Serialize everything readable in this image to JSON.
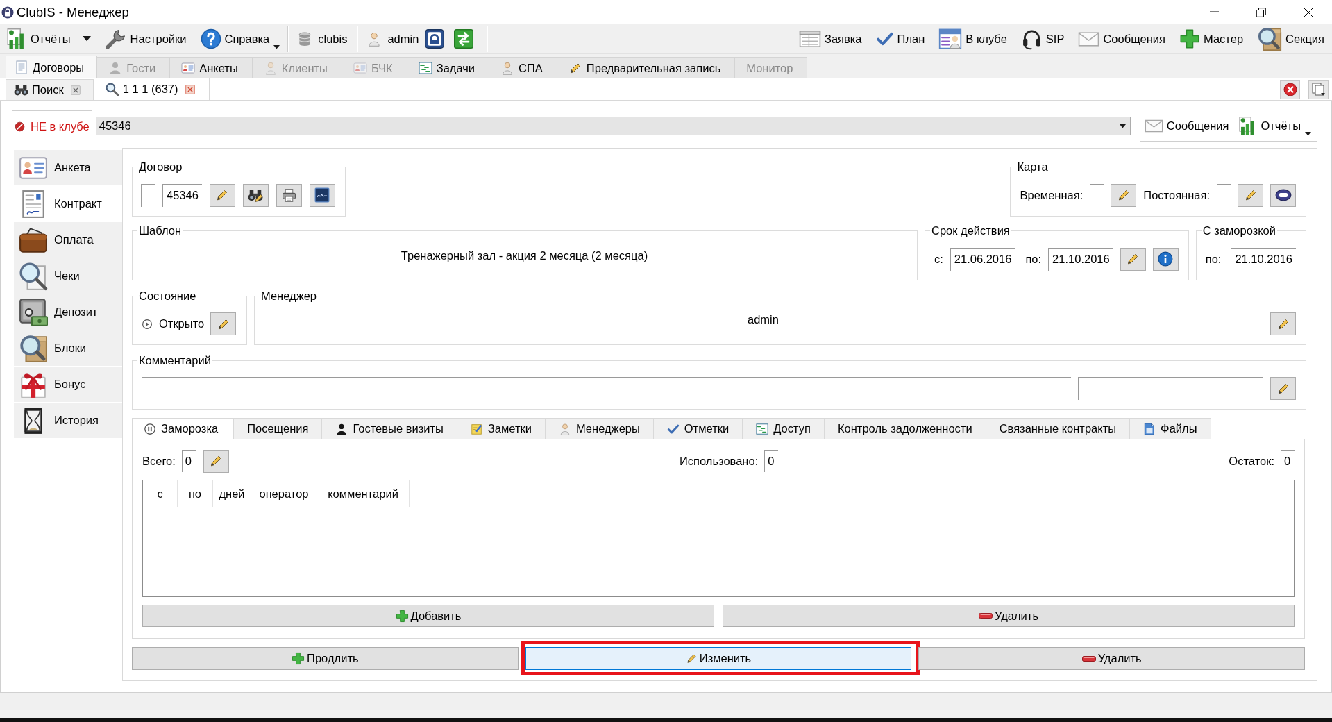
{
  "window": {
    "title": "ClubIS - Менеджер"
  },
  "toolbar": {
    "left": [
      {
        "label": "Отчёты",
        "kind": "dropdown"
      },
      {
        "label": "Настройки",
        "kind": "button"
      },
      {
        "label": "Справка",
        "kind": "menu"
      },
      {
        "label": "clubis",
        "kind": "database"
      },
      {
        "label": "admin",
        "kind": "user"
      }
    ],
    "right": [
      {
        "label": "Заявка"
      },
      {
        "label": "План"
      },
      {
        "label": "В клубе"
      },
      {
        "label": "SIP"
      },
      {
        "label": "Сообщения"
      },
      {
        "label": "Мастер"
      },
      {
        "label": "Секция"
      }
    ]
  },
  "main_tabs": [
    {
      "label": "Договоры",
      "selected": true,
      "disabled": false
    },
    {
      "label": "Гости",
      "selected": false,
      "disabled": true
    },
    {
      "label": "Анкеты",
      "selected": false,
      "disabled": false
    },
    {
      "label": "Клиенты",
      "selected": false,
      "disabled": true
    },
    {
      "label": "БЧК",
      "selected": false,
      "disabled": true
    },
    {
      "label": "Задачи",
      "selected": false,
      "disabled": false
    },
    {
      "label": "СПА",
      "selected": false,
      "disabled": false
    },
    {
      "label": "Предварительная запись",
      "selected": false,
      "disabled": false
    },
    {
      "label": "Монитор",
      "selected": false,
      "disabled": true
    }
  ],
  "document_tabs": [
    {
      "label": "Поиск",
      "selected": false
    },
    {
      "label": "1 1 1 (637)",
      "selected": true
    }
  ],
  "client": {
    "status": "НЕ в клубе",
    "in_club": false,
    "card_number": "45346",
    "buttons": [
      {
        "label": "Сообщения",
        "kind": "messages"
      },
      {
        "label": "Отчёты",
        "kind": "reports"
      }
    ]
  },
  "nav": [
    {
      "label": "Анкета",
      "selected": false
    },
    {
      "label": "Контракт",
      "selected": true
    },
    {
      "label": "Оплата",
      "selected": false
    },
    {
      "label": "Чеки",
      "selected": false
    },
    {
      "label": "Депозит",
      "selected": false
    },
    {
      "label": "Блоки",
      "selected": false
    },
    {
      "label": "Бонус",
      "selected": false
    },
    {
      "label": "История",
      "selected": false
    }
  ],
  "contract": {
    "title": "Договор",
    "number": "45346"
  },
  "card": {
    "title": "Карта",
    "fields": [
      {
        "label": "Временная:"
      },
      {
        "label": "Постоянная:"
      }
    ]
  },
  "template": {
    "title": "Шаблон",
    "value": "Тренажерный зал - акция 2 месяца (2 месяца)"
  },
  "validity": {
    "title": "Срок действия",
    "from_label": "с:",
    "from": "21.06.2016",
    "to_label": "по:",
    "to": "21.10.2016"
  },
  "with_freeze": {
    "title": "С заморозкой",
    "to_label": "по:",
    "to": "21.10.2016"
  },
  "state": {
    "title": "Состояние",
    "value": "Открыто"
  },
  "manager": {
    "title": "Менеджер",
    "value": "admin"
  },
  "comment": {
    "title": "Комментарий"
  },
  "detail_tabs": [
    {
      "label": "Заморозка",
      "selected": true
    },
    {
      "label": "Посещения",
      "selected": false
    },
    {
      "label": "Гостевые визиты",
      "selected": false
    },
    {
      "label": "Заметки",
      "selected": false
    },
    {
      "label": "Менеджеры",
      "selected": false
    },
    {
      "label": "Отметки",
      "selected": false
    },
    {
      "label": "Доступ",
      "selected": false
    },
    {
      "label": "Контроль задолженности",
      "selected": false
    },
    {
      "label": "Связанные контракты",
      "selected": false
    },
    {
      "label": "Файлы",
      "selected": false
    }
  ],
  "freeze": {
    "total_label": "Всего:",
    "total": "0",
    "used_label": "Использовано:",
    "used": "0",
    "rest_label": "Остаток:",
    "rest": "0",
    "columns": [
      "с",
      "по",
      "дней",
      "оператор",
      "комментарий"
    ],
    "buttons": [
      {
        "label": "Добавить",
        "kind": "add"
      },
      {
        "label": "Удалить",
        "kind": "delete"
      }
    ]
  },
  "actions": [
    {
      "label": "Продлить",
      "kind": "add",
      "focused": false,
      "highlighted": false
    },
    {
      "label": "Изменить",
      "kind": "edit",
      "focused": true,
      "highlighted": true
    },
    {
      "label": "Удалить",
      "kind": "delete",
      "focused": false,
      "highlighted": false
    }
  ]
}
